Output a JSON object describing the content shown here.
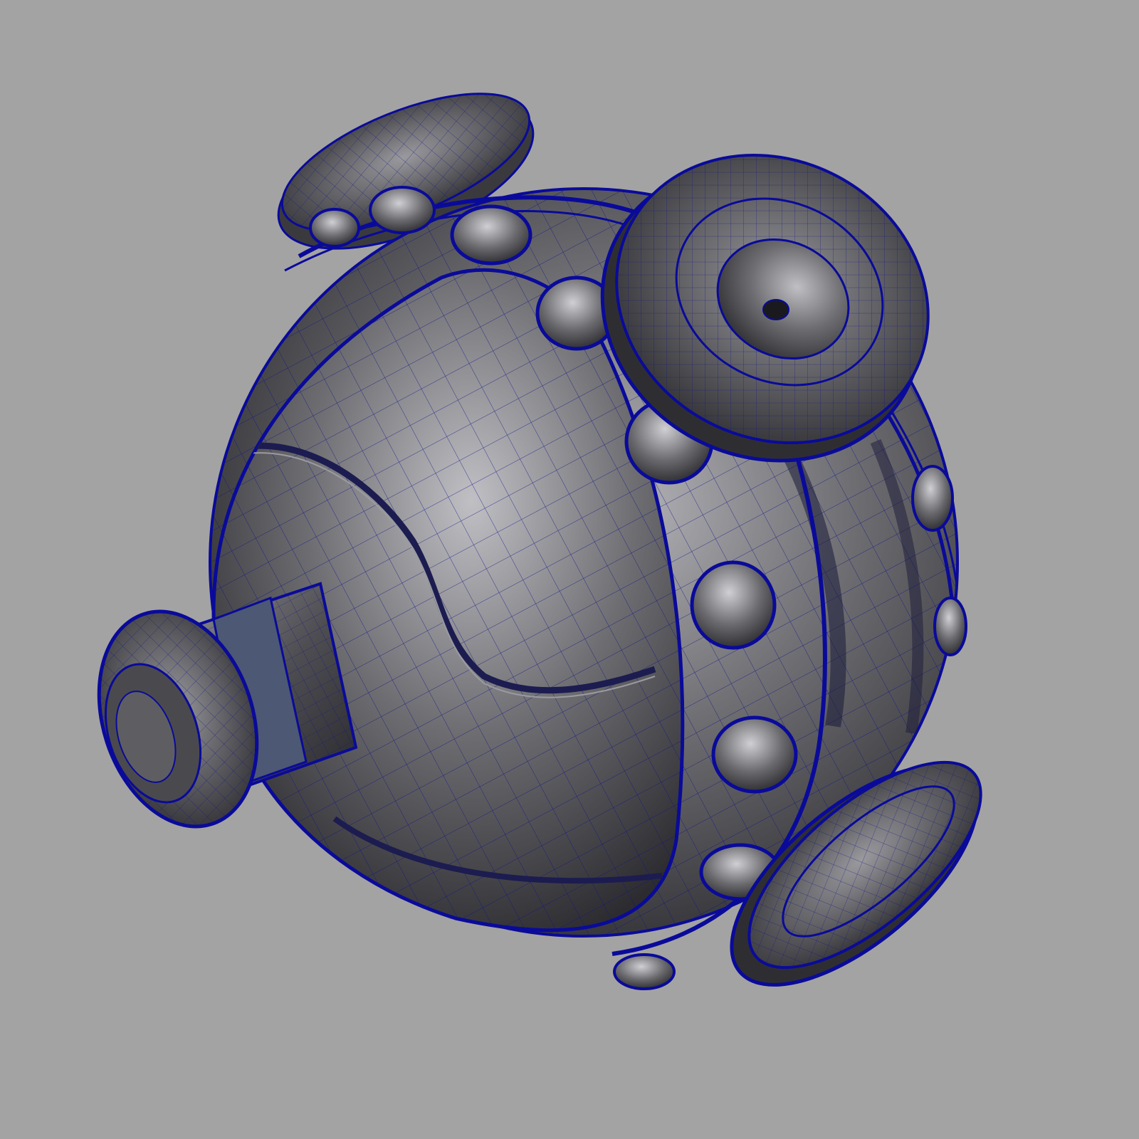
{
  "viewport": {
    "background_color": "#a3a3a3",
    "object": "mechanical-sphere-wireframe",
    "colors": {
      "shell_light": "#b4b4b8",
      "shell_mid": "#6a6a6e",
      "shell_dark": "#2a2a2e",
      "wireframe": "#101088",
      "wire_edge": "#0a0a9a",
      "accent_band": "#4c5874"
    },
    "parts": {
      "studs_ring": 10,
      "cylindrical_caps": 3
    }
  }
}
